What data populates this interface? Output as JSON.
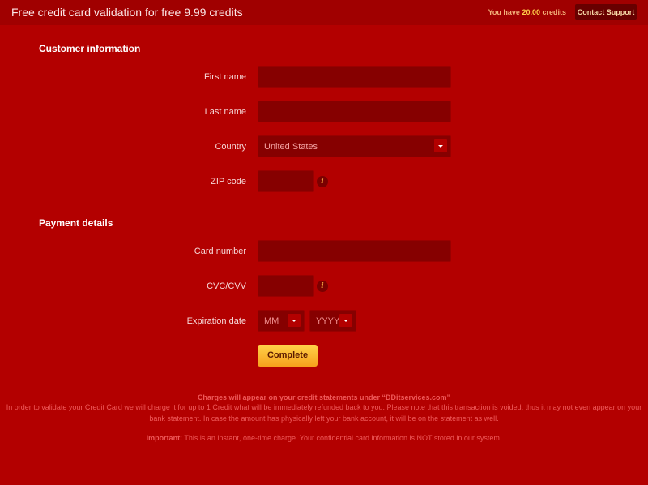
{
  "header": {
    "title": "Free credit card validation for free 9.99 credits",
    "credits_prefix": "You have",
    "credits_value": "20.00",
    "credits_suffix": "credits",
    "support_label": "Contact Support"
  },
  "customer": {
    "title": "Customer information",
    "first_name_label": "First name",
    "first_name_value": "",
    "last_name_label": "Last name",
    "last_name_value": "",
    "country_label": "Country",
    "country_value": "United States",
    "zip_label": "ZIP code",
    "zip_value": ""
  },
  "payment": {
    "title": "Payment details",
    "card_label": "Card number",
    "card_value": "",
    "cvc_label": "CVC/CVV",
    "cvc_value": "",
    "exp_label": "Expiration date",
    "month_value": "MM",
    "year_value": "YYYY",
    "info_glyph": "i"
  },
  "submit_label": "Complete",
  "footer": {
    "charges_line": "Charges will appear on your credit statements under “DDitservices.com”",
    "line1": "In order to validate your Credit Card we will charge it for up to 1 Credit what will be immediately refunded back to you. Please note that this transaction is voided, thus it may not even appear on your",
    "line2": "bank statement. In case the amount has physically left your bank account, it will be on the statement as well.",
    "important_label": "Important:",
    "important_text": "This is an instant, one-time charge. Your confidential card information is NOT stored in our system."
  }
}
